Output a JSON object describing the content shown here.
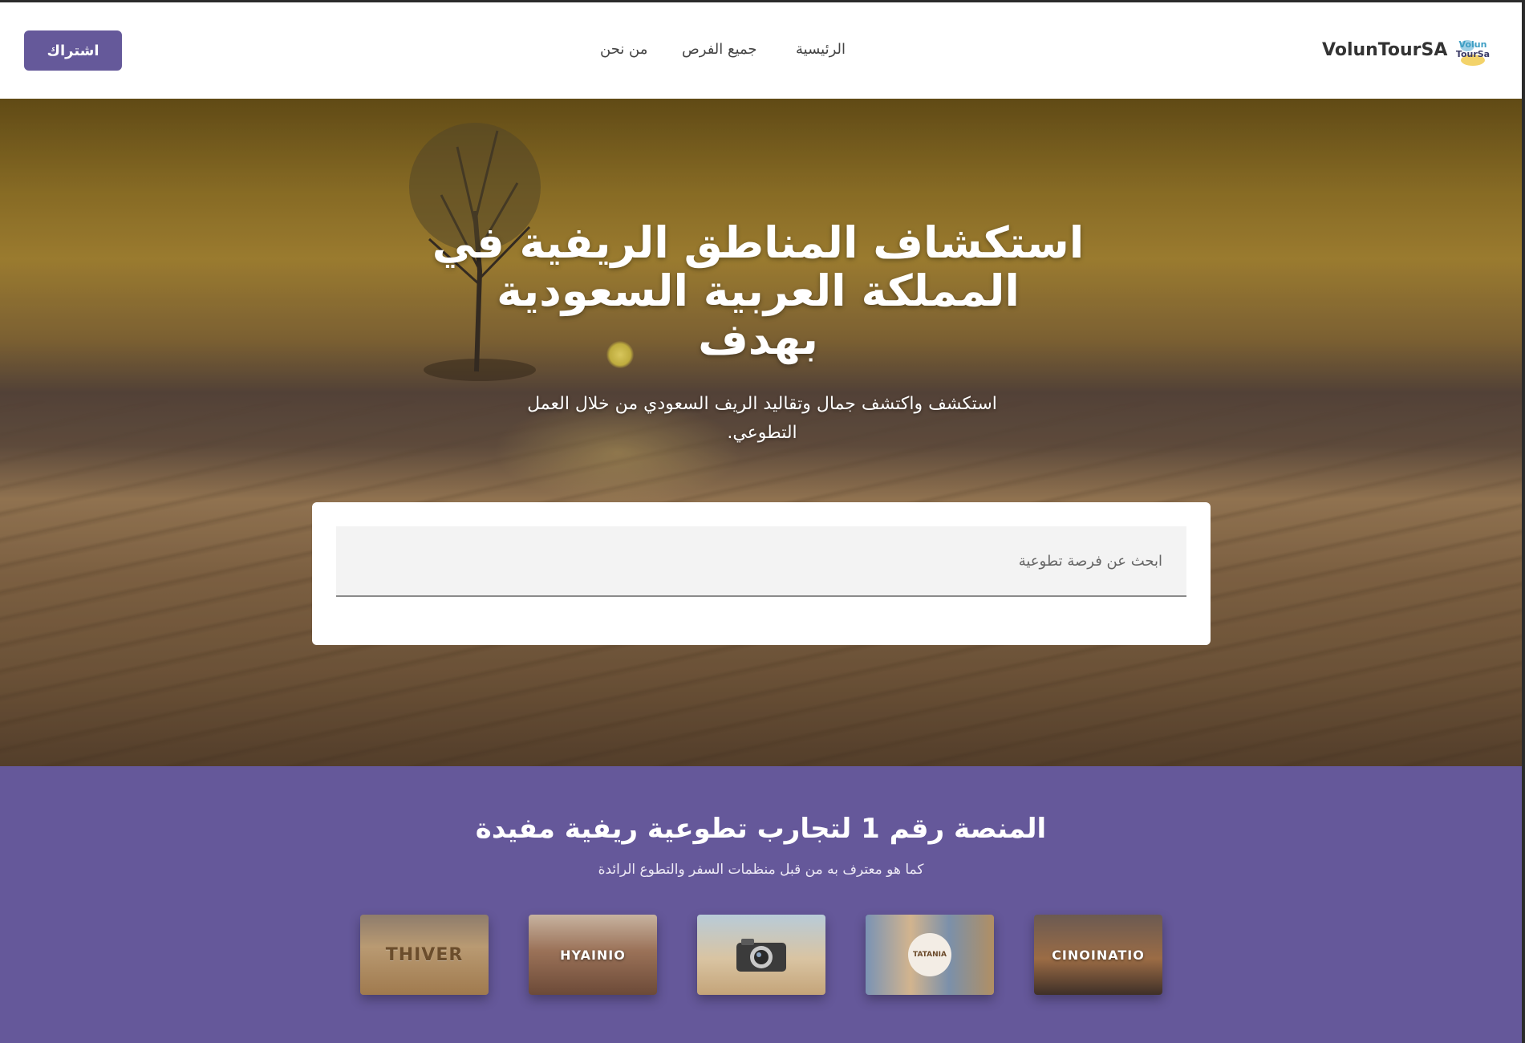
{
  "header": {
    "subscribe_label": "اشتراك",
    "nav": {
      "about": "من نحن",
      "all_opportunities": "جميع الفرص",
      "home": "الرئيسية"
    },
    "brand": "VolunTourSA",
    "logo_text_1": "Volun",
    "logo_text_2": "TourSa"
  },
  "hero": {
    "title_line1": "استكشاف المناطق الريفية في",
    "title_line2": "المملكة العربية السعودية",
    "title_line3": "بهدف",
    "subtitle": "استكشف واكتشف جمال وتقاليد الريف السعودي من خلال العمل التطوعي.",
    "search_placeholder": "ابحث عن فرصة تطوعية"
  },
  "partners": {
    "title": "المنصة رقم 1 لتجارب تطوعية ريفية مفيدة",
    "subtitle": "كما هو معترف به من قبل منظمات السفر والتطوع الرائدة",
    "logos": [
      "THIVER",
      "HYAINIO",
      "TATANIA",
      "CINOINATIO"
    ]
  },
  "colors": {
    "accent": "#65599a",
    "section_bg": "#65589a",
    "header_bg": "#ffffff"
  }
}
